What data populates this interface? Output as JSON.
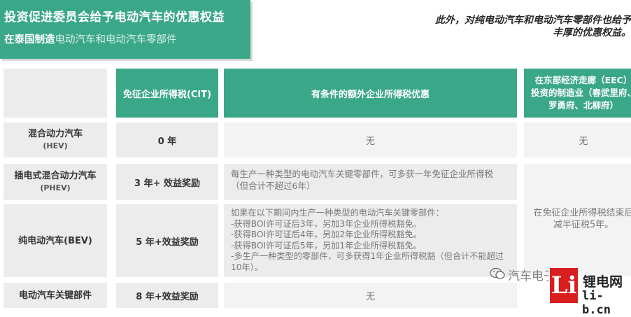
{
  "title": {
    "main": "投资促进委员会给予电动汽车的优惠权益",
    "sub_bold": "在泰国制造",
    "sub_rest": "电动汽车和电动汽车零部件"
  },
  "intro": {
    "line1": "此外，对纯电动汽车和电动汽车零部件也给予",
    "line2": "丰厚的优惠权益。"
  },
  "table": {
    "headers": {
      "cit": "免征企业所得税(CIT)",
      "extra": "有条件的额外企业所得税优惠",
      "eec": "在东部经济走廊（EEC）\n投资的制造业（春武里府、罗勇府、北柳府）"
    },
    "rows": [
      {
        "name": "混合动力汽车",
        "sub": "(HEV)",
        "cit": "0 年",
        "extra": "无",
        "eec": "无"
      },
      {
        "name": "插电式混合动力汽车",
        "sub": "(PHEV)",
        "cit": "3 年+ 效益奖励",
        "extra": "每生产一种类型的电动汽车关键零部件，可多获一年免征企业所得税（但合计不超过6年）"
      },
      {
        "name": "纯电动汽车(BEV)",
        "sub": "",
        "cit": "5 年+效益奖励",
        "extra": "如果在以下期间内生产一种类型的电动汽车关键零部件：\n-获得BOI许可证后3年，另加3年企业所得税豁免。\n-获得BOI许可证后4年，另加2年企业所得税豁免。\n-获得BOI许可证后5年，另加1年企业所得税豁免。\n-多生产一种类型的零部件，可多获得1年企业所得税豁（但合计不能超过10年）。"
      },
      {
        "name": "电动汽车关键部件",
        "sub": "",
        "cit": "8 年+效益奖励",
        "extra": "无"
      }
    ],
    "eec_shared": "在免征企业所得税结束后减半征税5年。"
  },
  "watermark": "汽车电子设计",
  "logo": {
    "mark": "Li",
    "text1": "锂电网",
    "text2": "li-b.cn"
  },
  "colors": {
    "accent": "#3aa888",
    "logo_red": "#d81e1e"
  }
}
